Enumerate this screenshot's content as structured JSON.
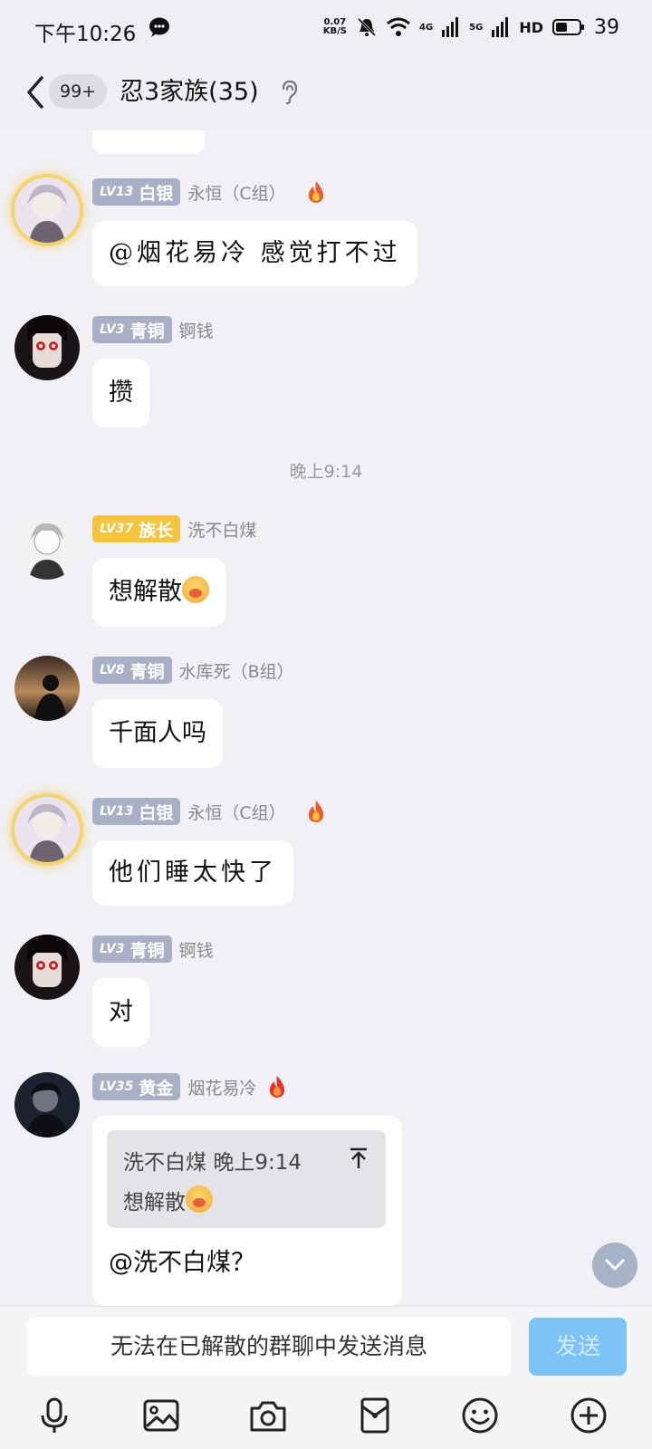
{
  "status_bar": {
    "time": "下午10:26",
    "net_speed_value": "0.07",
    "net_speed_unit": "KB/S",
    "signal_1_label": "4G",
    "signal_2_label": "5G",
    "hd_label": "HD",
    "battery": "39",
    "icons": [
      "chat-bubble-icon",
      "mute-icon",
      "wifi-icon",
      "signal-icon",
      "battery-icon"
    ]
  },
  "header": {
    "unread_badge": "99+",
    "title": "忍3家族(35)",
    "icons": [
      "back-icon",
      "ear-icon"
    ]
  },
  "timestamp": "晚上9:14",
  "messages": [
    {
      "level": "LV13",
      "rank": "白银",
      "nick": "永恒（C组）",
      "fire": true,
      "text": "@烟花易冷 感觉打不过",
      "style": "hand"
    },
    {
      "level": "LV3",
      "rank": "青铜",
      "nick": "锕钱",
      "fire": false,
      "text": "攒"
    },
    {
      "level": "LV37",
      "rank": "族长",
      "nick": "洗不白煤",
      "fire": false,
      "text": "想解散"
    },
    {
      "level": "LV8",
      "rank": "青铜",
      "nick": "水库死（B组）",
      "fire": false,
      "text": "千面人吗"
    },
    {
      "level": "LV13",
      "rank": "白银",
      "nick": "永恒（C组）",
      "fire": true,
      "text": "他们睡太快了",
      "style": "hand"
    },
    {
      "level": "LV3",
      "rank": "青铜",
      "nick": "锕钱",
      "fire": false,
      "text": "对"
    },
    {
      "level": "LV35",
      "rank": "黄金",
      "nick": "烟花易冷",
      "fire": true,
      "quote": {
        "author": "洗不白煤",
        "time": "晚上9:14",
        "text": "想解散"
      },
      "text": "@洗不白煤？"
    }
  ],
  "input": {
    "placeholder": "无法在已解散的群聊中发送消息",
    "send_label": "发送"
  },
  "toolbar": [
    "microphone-icon",
    "image-icon",
    "camera-icon",
    "red-packet-icon",
    "emoji-icon",
    "plus-icon"
  ],
  "colors": {
    "background": "#f1f1f5",
    "level_badge_gray": "#a9b0c6",
    "level_badge_gold": "#f5c43a",
    "send_button": "#7cc4f8"
  }
}
